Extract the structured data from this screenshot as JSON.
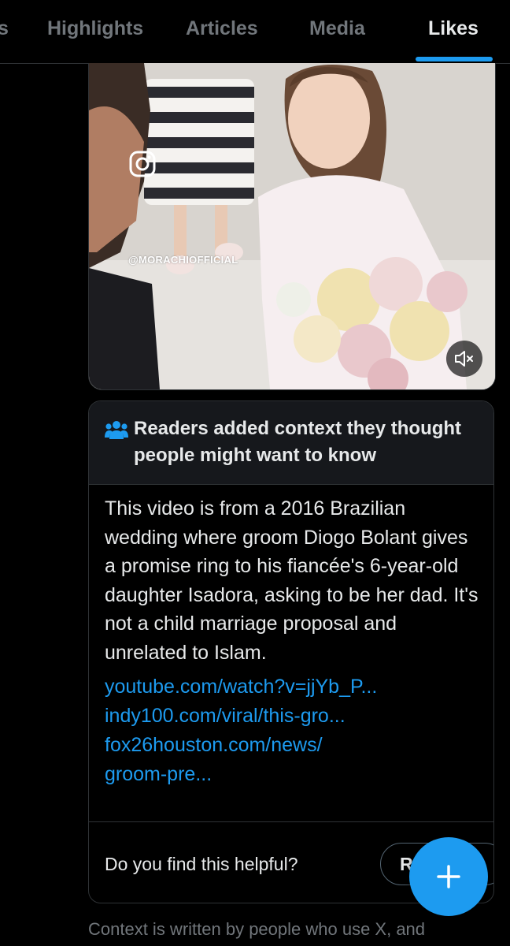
{
  "tabs": [
    {
      "label": "s"
    },
    {
      "label": "Highlights"
    },
    {
      "label": "Articles"
    },
    {
      "label": "Media"
    },
    {
      "label": "Likes"
    }
  ],
  "active_tab": "Likes",
  "media": {
    "watermark": "@MORACHIOFFICIAL",
    "mute_icon": "volume-muted-icon",
    "watermark_icon": "instagram-icon"
  },
  "note": {
    "header": "Readers added context they thought people might want to know",
    "body": "This video is from a 2016 Brazilian wedding where groom Diogo Bolant gives a promise ring to his fiancée's 6-year-old daughter Isadora, asking to be her dad. It's not a child marriage proposal and unrelated to Islam.",
    "links": [
      "youtube.com/watch?v=jjYb_P...",
      "indy100.com/viral/this-gro...",
      "fox26houston.com/news/",
      "groom-pre..."
    ],
    "question": "Do you find this helpful?",
    "rate_button": "R"
  },
  "footer": "Context is written by people who use X, and",
  "colors": {
    "accent": "#1d9bf0",
    "background": "#000000",
    "card_header": "#16181c",
    "muted_text": "#71767b"
  }
}
